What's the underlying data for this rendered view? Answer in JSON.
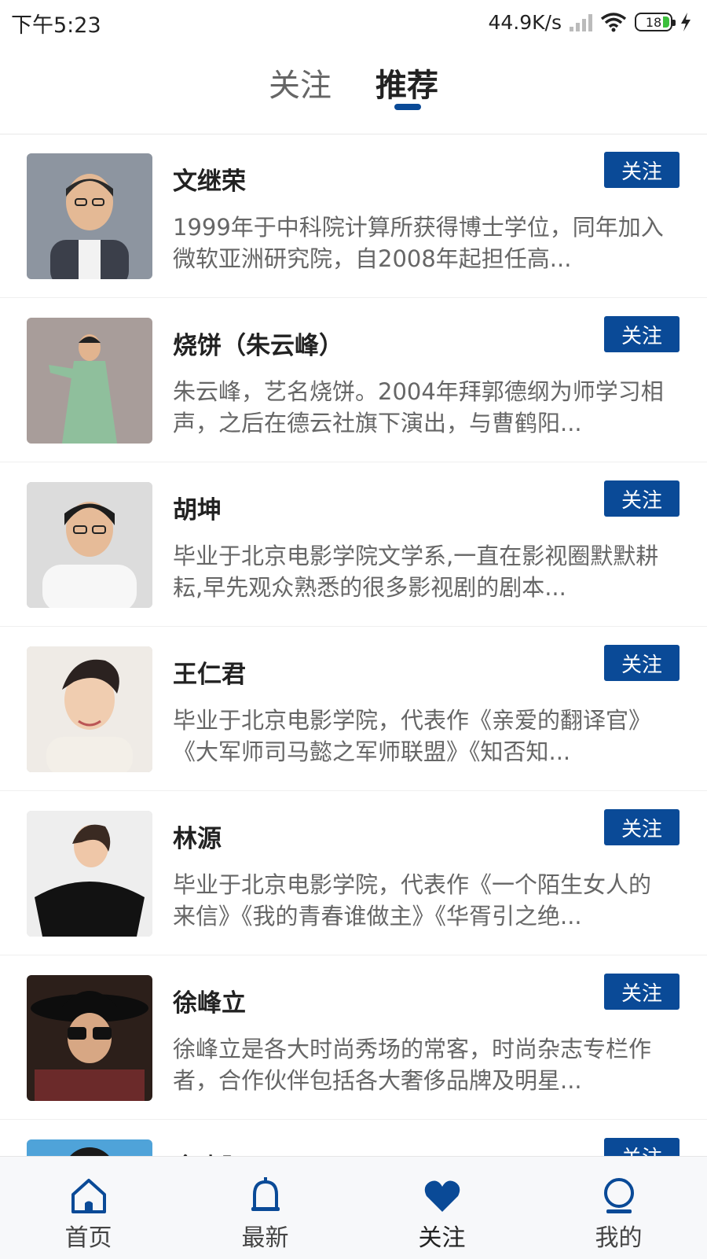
{
  "status_bar": {
    "time": "下午5:23",
    "speed": "44.9K/s",
    "battery": "18"
  },
  "tabs": {
    "follow": "关注",
    "recommend": "推荐"
  },
  "follow_label": "关注",
  "people": [
    {
      "name": "文继荣",
      "desc": "1999年于中科院计算所获得博士学位，同年加入微软亚洲研究院，自2008年起担任高..."
    },
    {
      "name": "烧饼（朱云峰）",
      "desc": "朱云峰，艺名烧饼。2004年拜郭德纲为师学习相声，之后在德云社旗下演出，与曹鹤阳..."
    },
    {
      "name": "胡坤",
      "desc": "毕业于北京电影学院文学系,一直在影视圈默默耕耘,早先观众熟悉的很多影视剧的剧本..."
    },
    {
      "name": "王仁君",
      "desc": "毕业于北京电影学院，代表作《亲爱的翻译官》《大军师司马懿之军师联盟》《知否知..."
    },
    {
      "name": "林源",
      "desc": "毕业于北京电影学院，代表作《一个陌生女人的来信》《我的青春谁做主》《华胥引之绝..."
    },
    {
      "name": "徐峰立",
      "desc": "徐峰立是各大时尚秀场的常客，时尚杂志专栏作者，合作伙伴包括各大奢侈品牌及明星..."
    },
    {
      "name": "金晓阳",
      "desc": ""
    }
  ],
  "bottom_nav": [
    {
      "label": "首页",
      "icon": "home-icon"
    },
    {
      "label": "最新",
      "icon": "bell-icon"
    },
    {
      "label": "关注",
      "icon": "heart-icon",
      "active": true
    },
    {
      "label": "我的",
      "icon": "profile-icon"
    }
  ],
  "colors": {
    "accent": "#0a4a97",
    "text": "#222222",
    "muted": "#666666"
  }
}
